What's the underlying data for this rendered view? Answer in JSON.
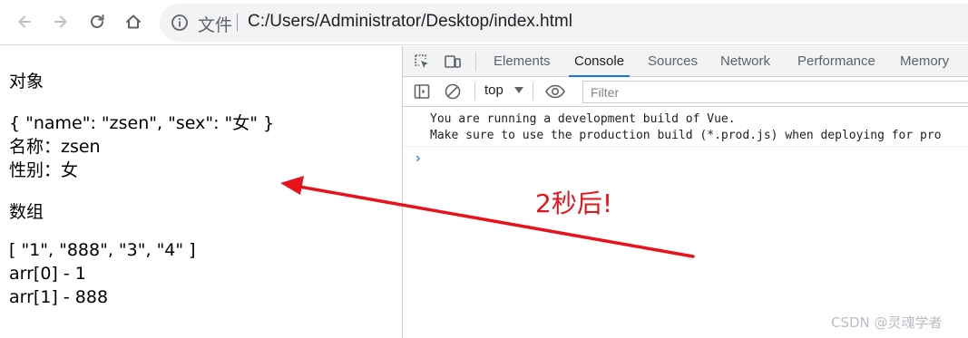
{
  "browser": {
    "nav": {
      "back_icon": "arrow-left-icon",
      "forward_icon": "arrow-right-icon",
      "reload_icon": "reload-icon",
      "home_icon": "home-icon"
    },
    "omnibox": {
      "info_icon": "info-icon",
      "scheme_label": "文件",
      "url": "C:/Users/Administrator/Desktop/index.html"
    }
  },
  "page": {
    "lines": [
      "对象",
      "{ \"name\": \"zsen\", \"sex\": \"女\" }",
      "名称：zsen",
      "性别：女",
      "数组",
      "[ \"1\", \"888\", \"3\", \"4\" ]",
      "arr[0] - 1",
      "arr[1] - 888"
    ]
  },
  "devtools": {
    "tabs": [
      "Elements",
      "Console",
      "Sources",
      "Network",
      "Performance",
      "Memory"
    ],
    "active_tab": "Console",
    "toolbar": {
      "context": "top",
      "filter_placeholder": "Filter"
    },
    "console": {
      "message": "You are running a development build of Vue.\nMake sure to use the production build (*.prod.js) when deploying for pro",
      "prompt": "›"
    },
    "accent_color": "#1a73e8"
  },
  "annotation": {
    "text": "2秒后!",
    "color": "#e8121b"
  },
  "watermark": "CSDN @灵魂学者"
}
